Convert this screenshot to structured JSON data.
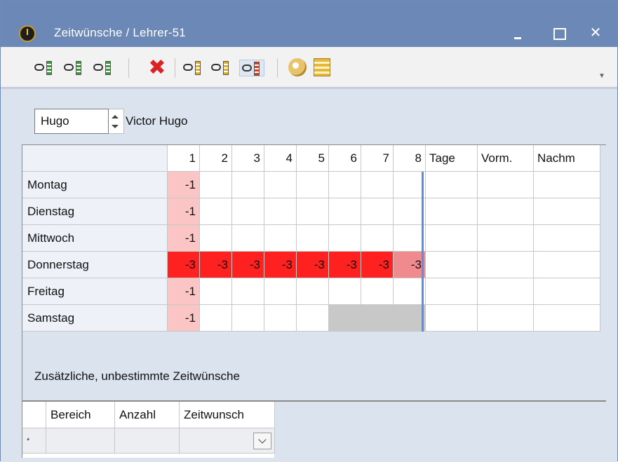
{
  "window": {
    "title": "Zeitwünsche / Lehrer-51",
    "controls": {
      "minimize": "_",
      "maximize": "□",
      "close": "✕"
    }
  },
  "toolbar": {
    "icons": [
      "wish-plus-3-icon",
      "wish-plus-2-icon",
      "wish-plus-1-icon",
      "delete-icon",
      "wish-minus-1-icon",
      "wish-minus-2-icon",
      "wish-minus-3-icon",
      "paint-icon",
      "list-edit-icon",
      "overflow-chevron-icon"
    ]
  },
  "teacher": {
    "code": "Hugo",
    "name": "Victor Hugo"
  },
  "grid": {
    "columns": [
      "",
      "1",
      "2",
      "3",
      "4",
      "5",
      "6",
      "7",
      "8",
      "Tage",
      "Vorm.",
      "Nachm"
    ],
    "rows": [
      {
        "day": "Montag",
        "cells": [
          "-1",
          "",
          "",
          "",
          "",
          "",
          "",
          ""
        ]
      },
      {
        "day": "Dienstag",
        "cells": [
          "-1",
          "",
          "",
          "",
          "",
          "",
          "",
          ""
        ]
      },
      {
        "day": "Mittwoch",
        "cells": [
          "-1",
          "",
          "",
          "",
          "",
          "",
          "",
          ""
        ]
      },
      {
        "day": "Donnerstag",
        "cells": [
          "-3",
          "-3",
          "-3",
          "-3",
          "-3",
          "-3",
          "-3",
          "-3"
        ]
      },
      {
        "day": "Freitag",
        "cells": [
          "-1",
          "",
          "",
          "",
          "",
          "",
          "",
          ""
        ]
      },
      {
        "day": "Samstag",
        "cells": [
          "-1",
          "",
          "",
          "",
          "",
          "",
          "",
          ""
        ]
      }
    ],
    "colors": {
      "minus1": "#fbc5c5",
      "minus3": "#ff2020",
      "minus3_light": "#ef8a8f",
      "unavailable": "#c8c8c8",
      "separator": "#5a8ee8"
    }
  },
  "extra": {
    "label": "Zusätzliche, unbestimmte Zeitwünsche",
    "columns": [
      "",
      "Bereich",
      "Anzahl",
      "Zeitwunsch"
    ],
    "new_row_marker": "*"
  }
}
